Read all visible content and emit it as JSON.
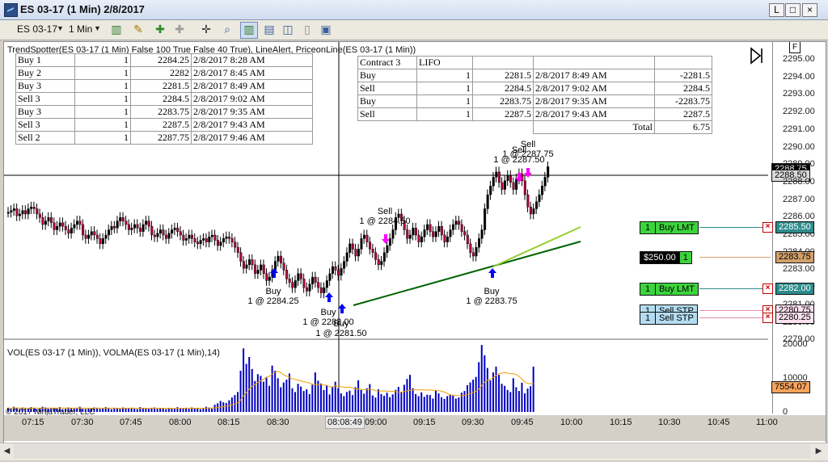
{
  "window": {
    "title": "ES 03-17 (1 Min)  2/8/2017",
    "buttons": [
      "L",
      "□",
      "×"
    ]
  },
  "toolbar": {
    "instrument": "ES 03-17",
    "interval": "1 Min",
    "icons": [
      "bars-icon",
      "pencil-icon",
      "zoom-in-icon",
      "zoom-out-icon",
      "crosshair-icon",
      "magnifier-icon",
      "chart-trader-icon",
      "data-box-icon",
      "indicator-icon",
      "strategy-icon",
      "properties-icon"
    ]
  },
  "chart": {
    "plot_label": "TrendSpotter(ES 03-17 (1 Min) False 100 True False 40 True), LineAlert, PriceonLine(ES 03-17 (1 Min))",
    "volume_label": "VOL(ES 03-17 (1 Min)), VOLMA(ES 03-17 (1 Min),14)",
    "copyright": "© 2017 NinjaTrader, LLC",
    "price_ticks": [
      "2295.00",
      "2294.00",
      "2293.00",
      "2292.00",
      "2291.00",
      "2290.00",
      "2289.00",
      "2288.00",
      "2287.00",
      "2286.00",
      "2285.00",
      "2284.00",
      "2283.00",
      "2282.00",
      "2281.00",
      "2280.00",
      "2279.00"
    ],
    "volume_ticks": [
      "20000",
      "10000",
      "0"
    ],
    "time_labels": [
      "07:15",
      "07:30",
      "07:45",
      "08:00",
      "08:15",
      "08:30",
      "08:45",
      "09:00",
      "09:15",
      "09:30",
      "09:45",
      "10:00",
      "10:15",
      "10:30",
      "10:45",
      "11:00"
    ],
    "crosshair_time": "08:49",
    "crosshair_date_prefix": "08:",
    "current_price": "2288.75",
    "crosshair_price": "2288.50",
    "volume_value": "7554.07"
  },
  "signals_table": [
    [
      "Buy 1",
      "1",
      "2284.25",
      "2/8/2017 8:28    AM"
    ],
    [
      "Buy 2",
      "1",
      "2282",
      "2/8/2017 8:45 AM"
    ],
    [
      "Buy 3",
      "1",
      "2281.5",
      "2/8/2017 8:49 AM"
    ],
    [
      "Sell 3",
      "1",
      "2284.5",
      "2/8/2017 9:02 AM"
    ],
    [
      "Buy 3",
      "1",
      "2283.75",
      "2/8/2017 9:35 AM"
    ],
    [
      "Sell 3",
      "1",
      "2287.5",
      "2/8/2017 9:43 AM"
    ],
    [
      "Sell 2",
      "1",
      "2287.75",
      "2/8/2017 9:46 AM"
    ]
  ],
  "lifo_table": {
    "header": [
      "Contract 3",
      "LIFO"
    ],
    "rows": [
      [
        "Buy",
        "1",
        "2281.5",
        "2/8/2017 8:49 AM",
        "-2281.5"
      ],
      [
        "Sell",
        "1",
        "2284.5",
        "2/8/2017 9:02 AM",
        "2284.5"
      ],
      [
        "Buy",
        "1",
        "2283.75",
        "2/8/2017 9:35 AM",
        "-2283.75"
      ],
      [
        "Sell",
        "1",
        "2287.5",
        "2/8/2017 9:43 AM",
        "2287.5"
      ]
    ],
    "total_label": "Total",
    "total_value": "6.75"
  },
  "trade_labels": [
    {
      "side": "Buy",
      "text": "1 @ 2284.25"
    },
    {
      "side": "Buy",
      "text": "1 @ 2282.00"
    },
    {
      "side": "Buy",
      "text": "1 @ 2281.50"
    },
    {
      "side": "Sell",
      "text": "1 @ 2284.50"
    },
    {
      "side": "Buy",
      "text": "1 @ 2283.75"
    },
    {
      "side": "Sell",
      "text": "1 @ 2287.50"
    },
    {
      "side": "Sell",
      "text": "1 @ 2287.75"
    }
  ],
  "orders": [
    {
      "qty": "1",
      "label": "Buy LMT",
      "price": "2285.50",
      "color": "#3cd43c"
    },
    {
      "qty": "$250.00",
      "label": "1",
      "price": "2283.75",
      "color": "#000000"
    },
    {
      "qty": "1",
      "label": "Buy LMT",
      "price": "2282.00",
      "color": "#3cd43c"
    },
    {
      "qty": "1",
      "label": "Sell STP",
      "price": "2280.75",
      "color": "#b4dcf0"
    },
    {
      "qty": "1",
      "label": "Sell STP",
      "price": "2280.25",
      "color": "#b4dcf0"
    }
  ],
  "colors": {
    "up_bar": "#000000",
    "down_bar": "#b0003a",
    "buy_arrow": "#0000ff",
    "sell_arrow": "#ff00ff",
    "trendline_dark": "#006400",
    "trendline_light": "#9acd32",
    "volume_bar": "#0000c0",
    "volume_ma": "#f0a000"
  }
}
